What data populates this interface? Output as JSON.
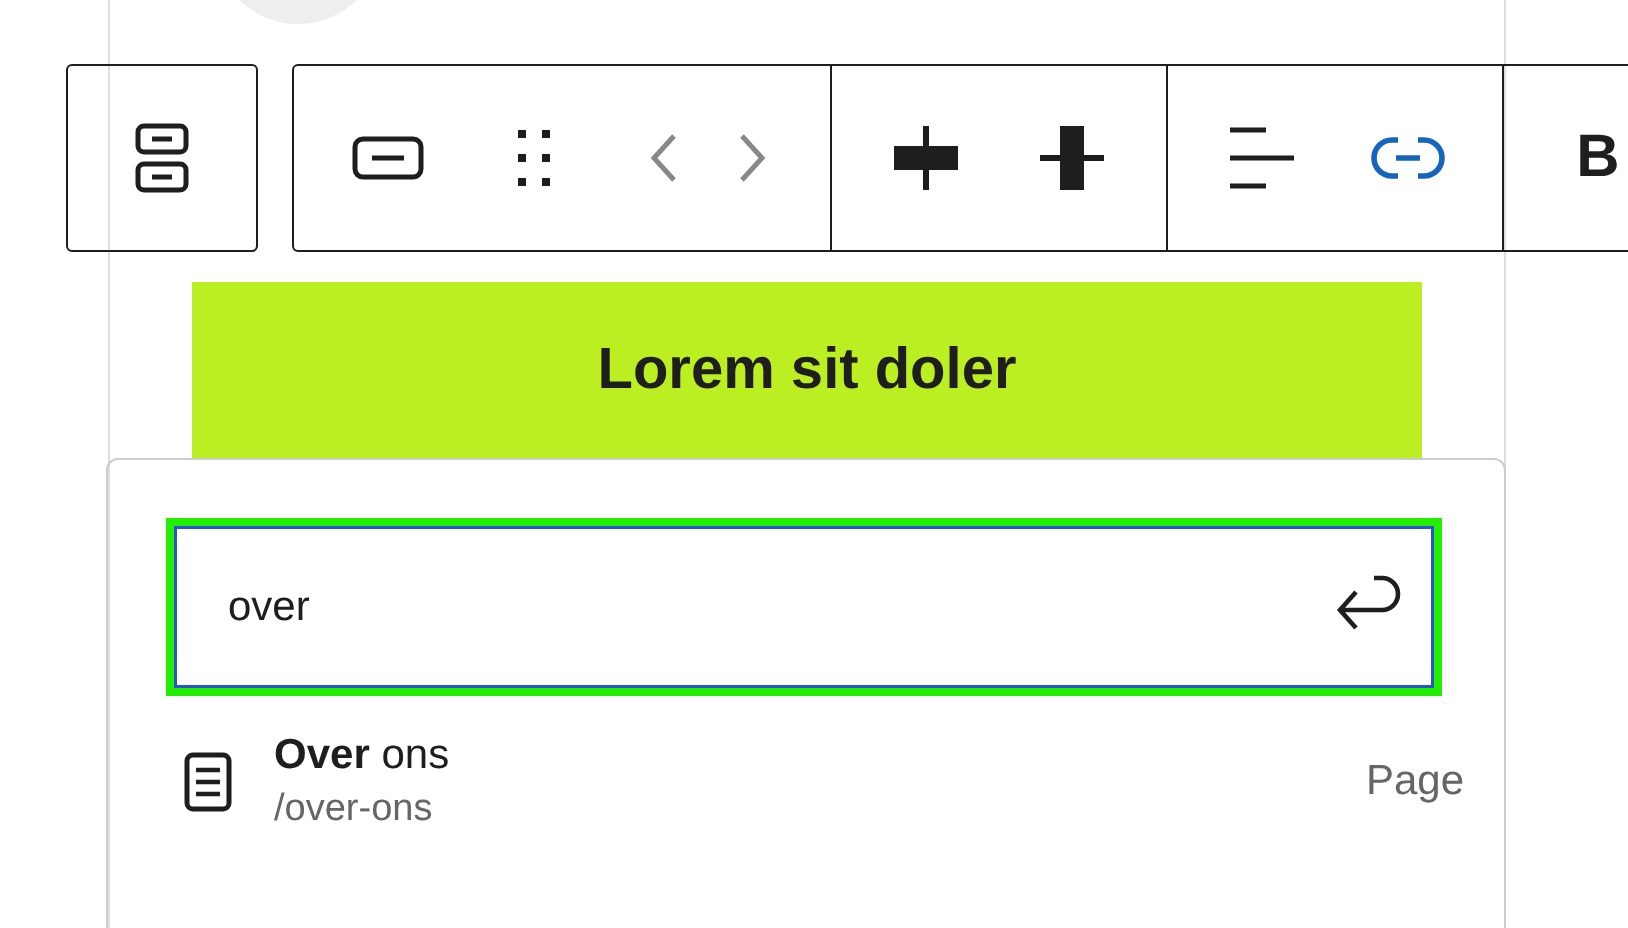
{
  "toolbar": {
    "groups": [
      [
        {
          "kind": "variant",
          "selected": false,
          "disabled": false
        }
      ],
      [
        {
          "kind": "block",
          "selected": false,
          "disabled": false
        },
        {
          "kind": "drag",
          "selected": false,
          "disabled": false
        },
        {
          "kind": "left",
          "selected": false,
          "disabled": true
        },
        {
          "kind": "right",
          "selected": false,
          "disabled": true
        }
      ],
      [
        {
          "kind": "justify-h",
          "selected": false,
          "disabled": false
        },
        {
          "kind": "justify-v",
          "selected": false,
          "disabled": false
        }
      ],
      [
        {
          "kind": "align",
          "selected": false,
          "disabled": false
        },
        {
          "kind": "link",
          "selected": true,
          "disabled": false
        }
      ],
      [
        {
          "kind": "bold",
          "label": "B",
          "selected": false,
          "disabled": false
        }
      ]
    ]
  },
  "button": {
    "label": "Lorem sit doler"
  },
  "link_popover": {
    "search": {
      "value": "over"
    },
    "results": [
      {
        "title": "**Over** ons",
        "url": "/over-ons",
        "type": "Page"
      }
    ]
  }
}
